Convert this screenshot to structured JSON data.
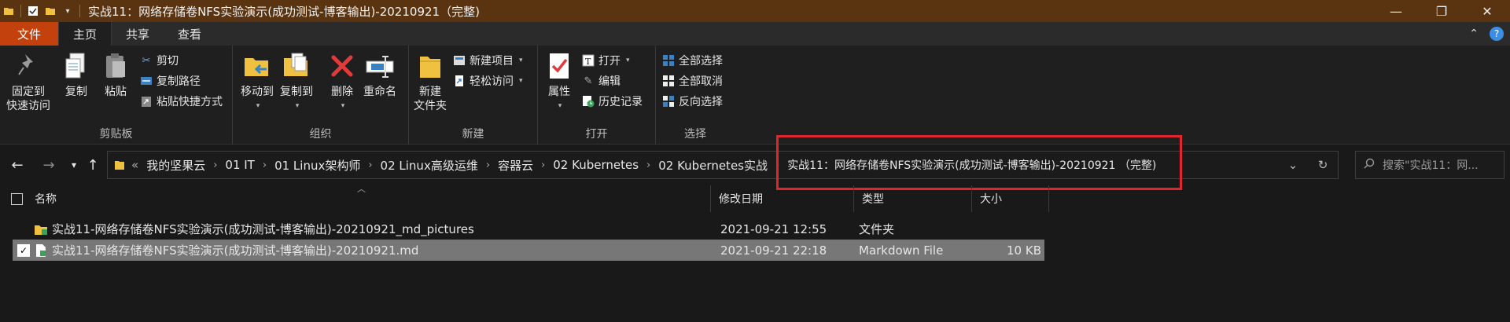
{
  "window": {
    "title": "实战11：网络存储卷NFS实验演示(成功测试-博客输出)-20210921（完整)",
    "controls": {
      "minimize": "—",
      "maximize": "❐",
      "close": "✕"
    }
  },
  "ribbon_tabs": {
    "file": "文件",
    "home": "主页",
    "share": "共享",
    "view": "查看"
  },
  "ribbon": {
    "clipboard": {
      "label": "剪贴板",
      "pin_line1": "固定到",
      "pin_line2": "快速访问",
      "copy": "复制",
      "paste": "粘贴",
      "cut": "剪切",
      "copy_path": "复制路径",
      "paste_shortcut": "粘贴快捷方式"
    },
    "organize": {
      "label": "组织",
      "move_to": "移动到",
      "copy_to": "复制到",
      "delete": "删除",
      "rename": "重命名"
    },
    "new": {
      "label": "新建",
      "new_folder_line1": "新建",
      "new_folder_line2": "文件夹",
      "new_item": "新建项目",
      "easy_access": "轻松访问"
    },
    "open": {
      "label": "打开",
      "properties": "属性",
      "open": "打开",
      "edit": "编辑",
      "history": "历史记录"
    },
    "select": {
      "label": "选择",
      "select_all": "全部选择",
      "select_none": "全部取消",
      "invert": "反向选择"
    }
  },
  "address_bar": {
    "overflow": "«",
    "crumbs": [
      "我的坚果云",
      "01 IT",
      "01 Linux架构师",
      "02 Linux高级运维",
      "容器云",
      "02 Kubernetes",
      "02 Kubernetes实战",
      "实战11：网络存储卷NFS实验演示(成功测试-博客输出)-20210921 （完整)"
    ],
    "search_placeholder": "搜索\"实战11：网..."
  },
  "columns": {
    "name": "名称",
    "modified": "修改日期",
    "type": "类型",
    "size": "大小"
  },
  "files": [
    {
      "name": "实战11-网络存储卷NFS实验演示(成功测试-博客输出)-20210921_md_pictures",
      "modified": "2021-09-21 12:55",
      "type": "文件夹",
      "size": "",
      "selected": false
    },
    {
      "name": "实战11-网络存储卷NFS实验演示(成功测试-博客输出)-20210921.md",
      "modified": "2021-09-21 22:18",
      "type": "Markdown File",
      "size": "10 KB",
      "selected": true
    }
  ],
  "colors": {
    "titlebar": "#5a3410",
    "file_tab": "#c2410c",
    "highlight_box": "#e0262b",
    "selection": "#777777"
  }
}
